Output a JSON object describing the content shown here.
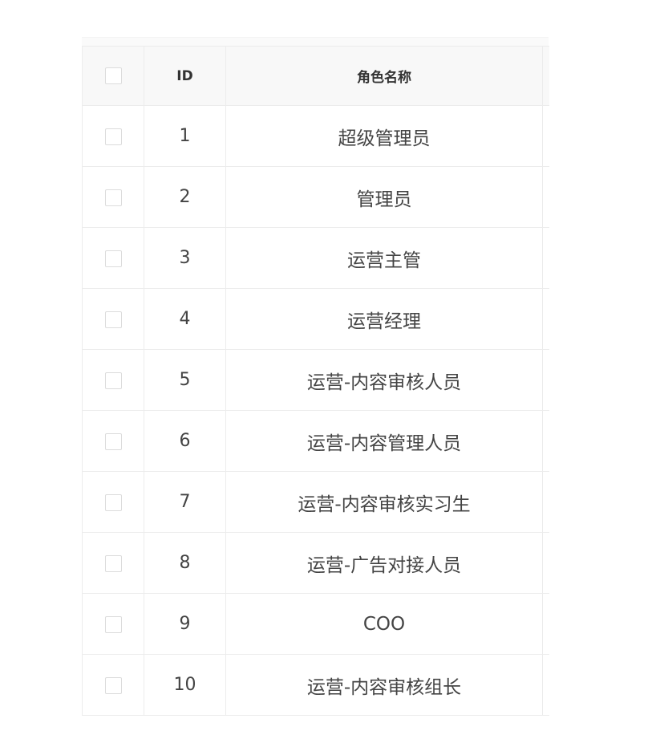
{
  "table": {
    "headers": {
      "select_all": "",
      "id": "ID",
      "role_name": "角色名称"
    },
    "rows": [
      {
        "id": "1",
        "role_name": "超级管理员",
        "checked": false
      },
      {
        "id": "2",
        "role_name": "管理员",
        "checked": false
      },
      {
        "id": "3",
        "role_name": "运营主管",
        "checked": false
      },
      {
        "id": "4",
        "role_name": "运营经理",
        "checked": false
      },
      {
        "id": "5",
        "role_name": "运营-内容审核人员",
        "checked": false
      },
      {
        "id": "6",
        "role_name": "运营-内容管理人员",
        "checked": false
      },
      {
        "id": "7",
        "role_name": "运营-内容审核实习生",
        "checked": false
      },
      {
        "id": "8",
        "role_name": "运营-广告对接人员",
        "checked": false
      },
      {
        "id": "9",
        "role_name": "COO",
        "checked": false
      },
      {
        "id": "10",
        "role_name": "运营-内容审核组长",
        "checked": false
      }
    ]
  }
}
